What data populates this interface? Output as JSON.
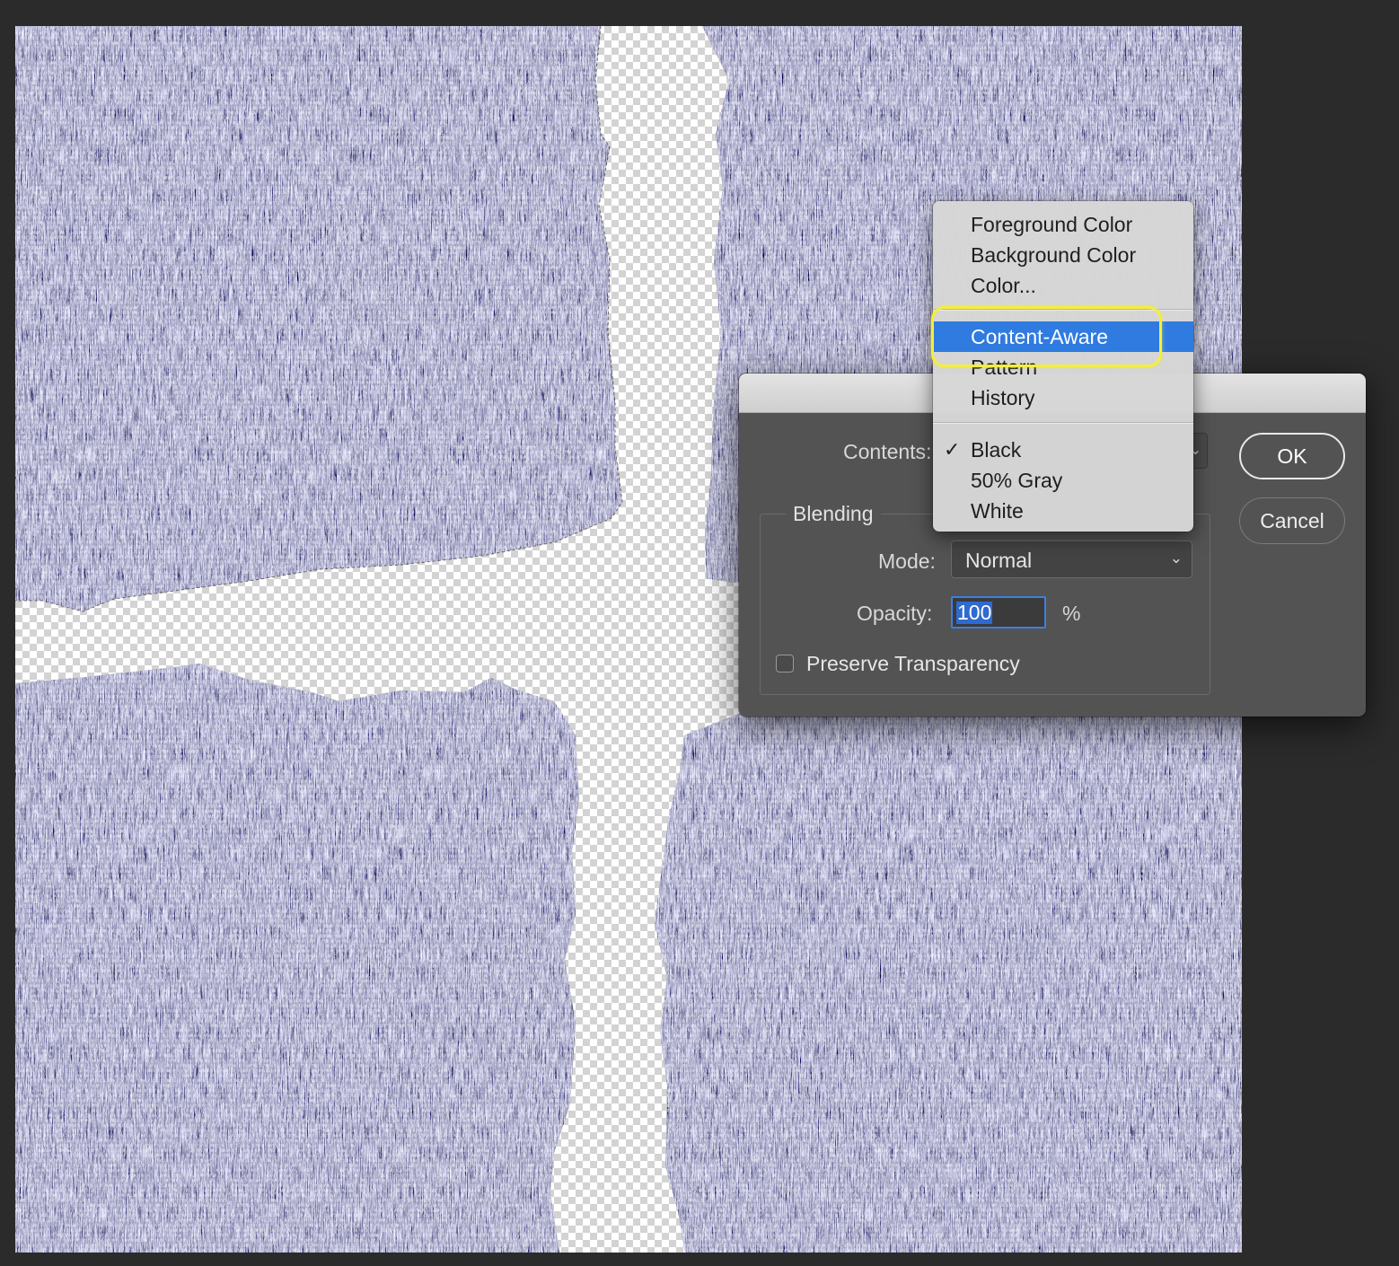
{
  "dialog": {
    "contents_label": "Contents:",
    "blending_legend": "Blending",
    "mode_label": "Mode:",
    "mode_value": "Normal",
    "opacity_label": "Opacity:",
    "opacity_value": "100",
    "opacity_unit": "%",
    "preserve_transparency_label": "Preserve Transparency",
    "preserve_transparency_checked": false,
    "ok_label": "OK",
    "cancel_label": "Cancel"
  },
  "contents_menu": {
    "items": [
      {
        "label": "Foreground Color"
      },
      {
        "label": "Background Color"
      },
      {
        "label": "Color..."
      },
      {
        "label": "Content-Aware",
        "highlighted": true
      },
      {
        "label": "Pattern"
      },
      {
        "label": "History"
      },
      {
        "label": "Black",
        "checked": true
      },
      {
        "label": "50% Gray"
      },
      {
        "label": "White"
      }
    ],
    "check_glyph": "✓"
  },
  "colors": {
    "app_background": "#2b2b2b",
    "dialog_background": "#535353",
    "menu_selection": "#2f7be0",
    "annotation_highlight": "#f3ef3a",
    "transparency_checker_light": "#ffffff",
    "transparency_checker_dark": "#d0d0d0",
    "fabric_texture": "#7a7a7a"
  },
  "icons": {
    "mode_dropdown": "chevron-down-icon",
    "contents_dropdown": "chevron-down-icon",
    "selected_item": "checkmark-icon"
  }
}
